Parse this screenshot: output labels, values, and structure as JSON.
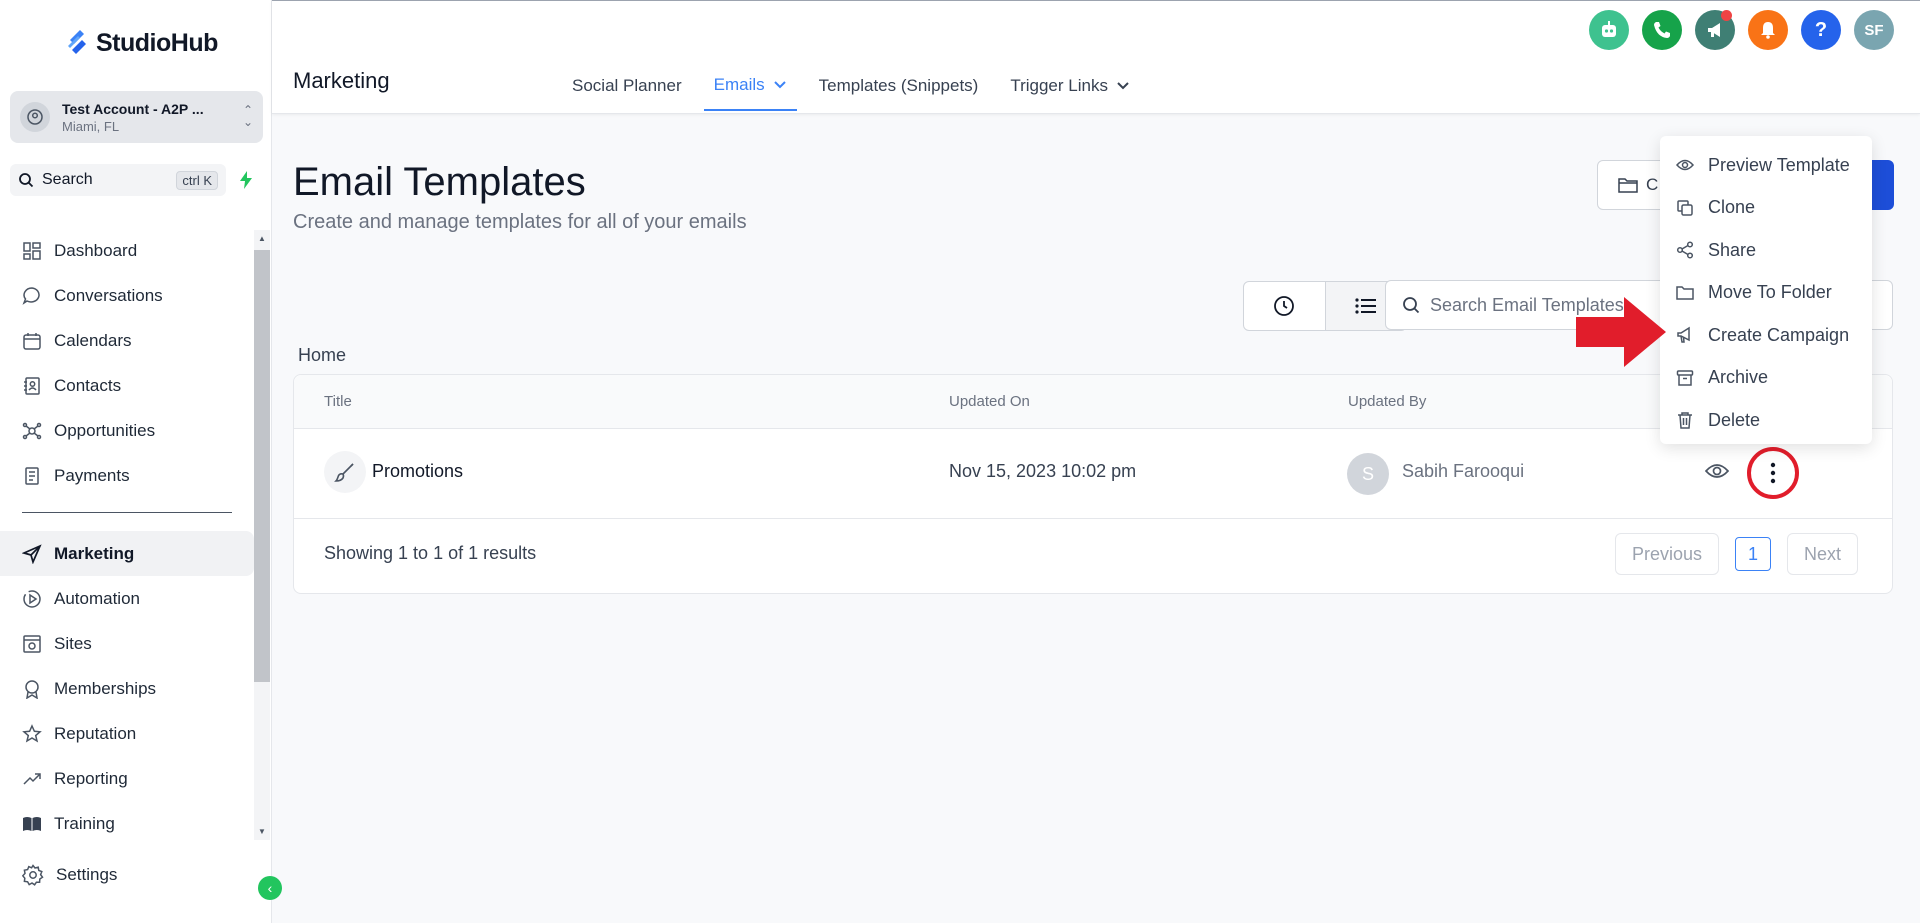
{
  "brand": {
    "name": "StudioHub",
    "accent": "#3b82f6"
  },
  "account": {
    "name": "Test Account - A2P ...",
    "location": "Miami, FL"
  },
  "sidebar": {
    "search_label": "Search",
    "shortcut": "ctrl K",
    "items": [
      {
        "label": "Dashboard",
        "icon": "dashboard-icon"
      },
      {
        "label": "Conversations",
        "icon": "chat-icon"
      },
      {
        "label": "Calendars",
        "icon": "calendar-icon"
      },
      {
        "label": "Contacts",
        "icon": "contacts-icon"
      },
      {
        "label": "Opportunities",
        "icon": "opportunities-icon"
      },
      {
        "label": "Payments",
        "icon": "payments-icon"
      }
    ],
    "items2": [
      {
        "label": "Marketing",
        "icon": "send-icon",
        "active": true
      },
      {
        "label": "Automation",
        "icon": "automation-icon"
      },
      {
        "label": "Sites",
        "icon": "sites-icon"
      },
      {
        "label": "Memberships",
        "icon": "badge-icon"
      },
      {
        "label": "Reputation",
        "icon": "star-icon"
      },
      {
        "label": "Reporting",
        "icon": "trend-icon"
      },
      {
        "label": "Training",
        "icon": "book-icon"
      }
    ],
    "settings_label": "Settings"
  },
  "header": {
    "title": "Marketing",
    "tabs": [
      {
        "label": "Social Planner"
      },
      {
        "label": "Emails",
        "active": true
      },
      {
        "label": "Templates (Snippets)"
      },
      {
        "label": "Trigger Links"
      }
    ],
    "user_initials": "SF",
    "help_label": "?"
  },
  "main": {
    "title": "Email Templates",
    "subtitle": "Create and manage templates for all of your emails",
    "folder_button_label": "C",
    "search_placeholder": "Search Email Templates",
    "breadcrumb": "Home",
    "table": {
      "columns": [
        "Title",
        "Updated On",
        "Updated By"
      ],
      "rows": [
        {
          "title": "Promotions",
          "updated_on": "Nov 15, 2023 10:02 pm",
          "updated_by": "Sabih Farooqui",
          "avatar": "S"
        }
      ]
    },
    "footer": {
      "showing": "Showing 1 to 1 of 1 results",
      "previous": "Previous",
      "page": "1",
      "next": "Next"
    }
  },
  "context_menu": {
    "items": [
      {
        "label": "Preview Template",
        "icon": "eye-icon"
      },
      {
        "label": "Clone",
        "icon": "copy-icon"
      },
      {
        "label": "Share",
        "icon": "share-icon"
      },
      {
        "label": "Move To Folder",
        "icon": "folder-icon"
      },
      {
        "label": "Create Campaign",
        "icon": "megaphone-icon"
      },
      {
        "label": "Archive",
        "icon": "archive-icon"
      },
      {
        "label": "Delete",
        "icon": "trash-icon"
      }
    ]
  },
  "colors": {
    "annotation_red": "#e11d2b",
    "primary_blue": "#1d4ed8"
  }
}
